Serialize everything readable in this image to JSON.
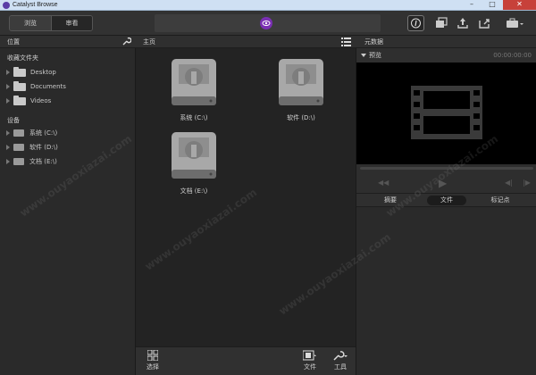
{
  "window": {
    "title": "Catalyst Browse",
    "min": "–",
    "max": "□",
    "close": "✕"
  },
  "toolbar": {
    "browse_label": "浏览",
    "review_label": "审看"
  },
  "left_panel": {
    "header": "位置",
    "favorites_title": "收藏文件夹",
    "favorites": [
      {
        "label": "Desktop",
        "icon": "folder-icon"
      },
      {
        "label": "Documents",
        "icon": "folder-icon"
      },
      {
        "label": "Videos",
        "icon": "folder-icon"
      }
    ],
    "devices_title": "设备",
    "devices": [
      {
        "label": "系统 (C:\\)",
        "icon": "drive-icon"
      },
      {
        "label": "软件 (D:\\)",
        "icon": "drive-icon"
      },
      {
        "label": "文档 (E:\\)",
        "icon": "drive-icon"
      }
    ]
  },
  "center": {
    "header": "主页",
    "drives": [
      {
        "label": "系统 (C:\\)"
      },
      {
        "label": "软件 (D:\\)"
      },
      {
        "label": "文档 (E:\\)"
      }
    ],
    "bottom": {
      "select_label": "选择",
      "file_label": "文件",
      "tools_label": "工具"
    }
  },
  "right_panel": {
    "header": "元数据",
    "preview_title": "预览",
    "timecode": "00:00:00:00",
    "tabs": [
      {
        "label": "摘要",
        "active": false
      },
      {
        "label": "文件",
        "active": true
      },
      {
        "label": "标记点",
        "active": false
      }
    ]
  },
  "watermark": "www.ouyaoxiazai.com",
  "colors": {
    "accent": "#7a2fb3",
    "background": "#2b2b2b",
    "close_button": "#c7413a"
  }
}
